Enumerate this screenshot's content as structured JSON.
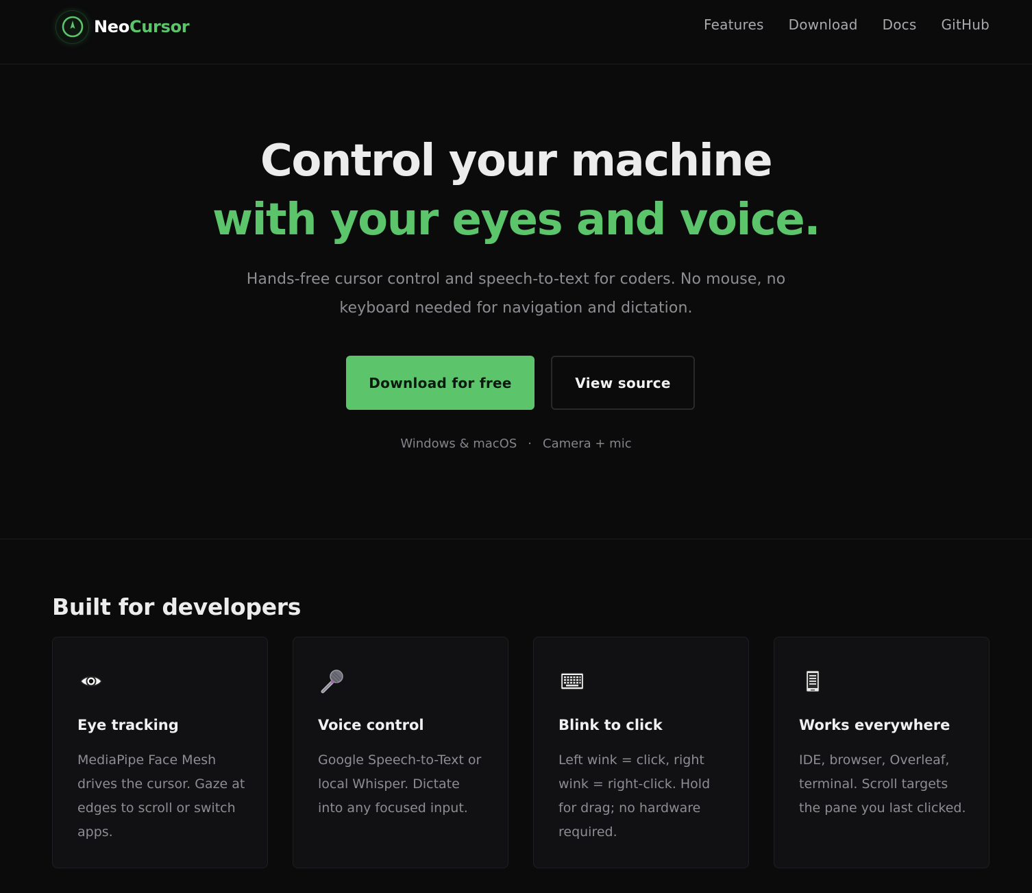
{
  "nav": {
    "brand_part1": "Neo",
    "brand_part2": "Cursor",
    "links": [
      "Features",
      "Download",
      "Docs",
      "GitHub"
    ]
  },
  "hero": {
    "line1": "Control your machine",
    "line2": "with your eyes and voice.",
    "subtitle": "Hands-free cursor control and speech-to-text for coders. No mouse, no keyboard needed for navigation and dictation.",
    "primary_button": "Download for free",
    "secondary_button": "View source",
    "meta_left": "Windows & macOS",
    "meta_sep": "·",
    "meta_right": "Camera + mic"
  },
  "features": {
    "title": "Built for developers",
    "cards": [
      {
        "icon": "eye-icon",
        "title": "Eye tracking",
        "text": "MediaPipe Face Mesh drives the cursor. Gaze at edges to scroll or switch apps."
      },
      {
        "icon": "microphone-icon",
        "title": "Voice control",
        "text": "Google Speech-to-Text or local Whisper. Dictate into any focused input."
      },
      {
        "icon": "keyboard-icon",
        "title": "Blink to click",
        "text": "Left wink = click, right wink = right-click. Hold for drag; no hardware required."
      },
      {
        "icon": "phone-icon",
        "title": "Works everywhere",
        "text": "IDE, browser, Overleaf, terminal. Scroll targets the pane you last clicked."
      }
    ]
  },
  "colors": {
    "accent": "#5cc46a",
    "background": "#0b0b0c",
    "card": "#111113"
  }
}
